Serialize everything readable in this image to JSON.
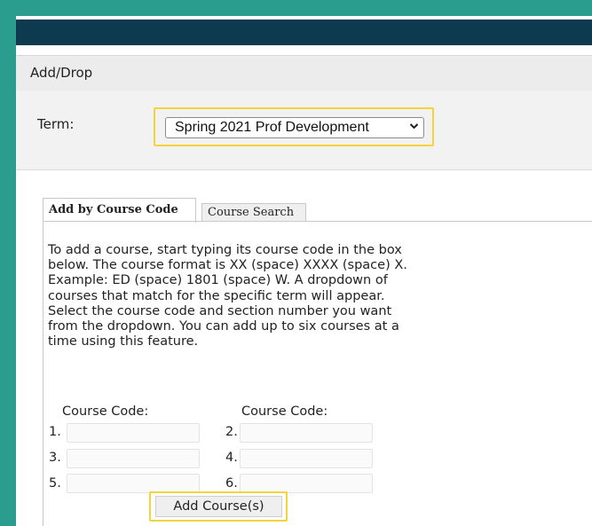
{
  "section": {
    "title": "Add/Drop"
  },
  "term": {
    "label": "Term:",
    "selected": "Spring 2021 Prof Development"
  },
  "tabs": [
    {
      "label": "Add by Course Code",
      "active": true
    },
    {
      "label": "Course Search",
      "active": false
    }
  ],
  "instructions": "To add a course, start typing its course code in the box below. The course format is XX (space) XXXX (space) X. Example: ED (space) 1801 (space) W. A dropdown of courses that match for the specific term will appear. Select the course code and section number you want from the dropdown. You can add up to six courses at a time using this feature.",
  "course_entry": {
    "column_headers": [
      "Course Code:",
      "Course Code:"
    ],
    "rows": [
      {
        "left_num": "1.",
        "left_value": "",
        "right_num": "2.",
        "right_value": ""
      },
      {
        "left_num": "3.",
        "left_value": "",
        "right_num": "4.",
        "right_value": ""
      },
      {
        "left_num": "5.",
        "left_value": "",
        "right_num": "6.",
        "right_value": ""
      }
    ]
  },
  "add_button": {
    "label": "Add Course(s)"
  },
  "colors": {
    "outer_background": "#2a9d8f",
    "top_bar": "#0d3a4e",
    "highlight": "#f5d33a"
  },
  "icons": {
    "select_chevron": "chevron-down-icon"
  }
}
